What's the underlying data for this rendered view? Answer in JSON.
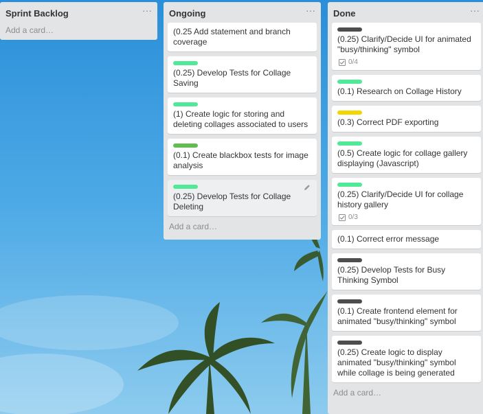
{
  "lists": [
    {
      "title": "Sprint Backlog",
      "menu": "···",
      "add_card": "Add a card…",
      "cards": []
    },
    {
      "title": "Ongoing",
      "menu": "···",
      "add_card": "Add a card…",
      "cards": [
        {
          "label_color": "",
          "text": "(0.25 Add statement and branch coverage"
        },
        {
          "label_color": "#51e898",
          "text": "(0.25) Develop Tests for Collage Saving"
        },
        {
          "label_color": "#51e898",
          "text": "(1) Create logic for storing and deleting collages associated to users"
        },
        {
          "label_color": "#61bd4f",
          "text": "(0.1) Create blackbox tests for image analysis"
        },
        {
          "label_color": "#51e898",
          "text": "(0.25) Develop Tests for Collage Deleting"
        }
      ]
    },
    {
      "title": "Done",
      "menu": "···",
      "add_card": "Add a card…",
      "cards": [
        {
          "label_color": "#4d4d4d",
          "text": "(0.25) Clarify/Decide UI for animated \"busy/thinking\" symbol",
          "checklist": "0/4"
        },
        {
          "label_color": "#51e898",
          "text": "(0.1) Research on Collage History"
        },
        {
          "label_color": "#f2d600",
          "text": "(0.3) Correct PDF exporting"
        },
        {
          "label_color": "#51e898",
          "text": "(0.5) Create logic for collage gallery displaying (Javascript)"
        },
        {
          "label_color": "#51e898",
          "text": "(0.25) Clarify/Decide UI for collage history gallery",
          "checklist": "0/3"
        },
        {
          "label_color": "",
          "text": "(0.1) Correct error message"
        },
        {
          "label_color": "#4d4d4d",
          "text": "(0.25) Develop Tests for Busy Thinking Symbol"
        },
        {
          "label_color": "#4d4d4d",
          "text": "(0.1) Create frontend element for animated \"busy/thinking\" symbol"
        },
        {
          "label_color": "#4d4d4d",
          "text": "(0.25) Create logic to display animated \"busy/thinking\" symbol while collage is being generated"
        }
      ]
    }
  ],
  "icons": {
    "list_menu": "ellipsis-icon",
    "checklist": "checkbox-icon",
    "card_edit": "pencil-icon"
  },
  "colors": {
    "list_background": "#e2e4e6",
    "card_background": "#ffffff",
    "hovered_card_background": "#edeff0",
    "muted_text": "#8c8c8c"
  }
}
